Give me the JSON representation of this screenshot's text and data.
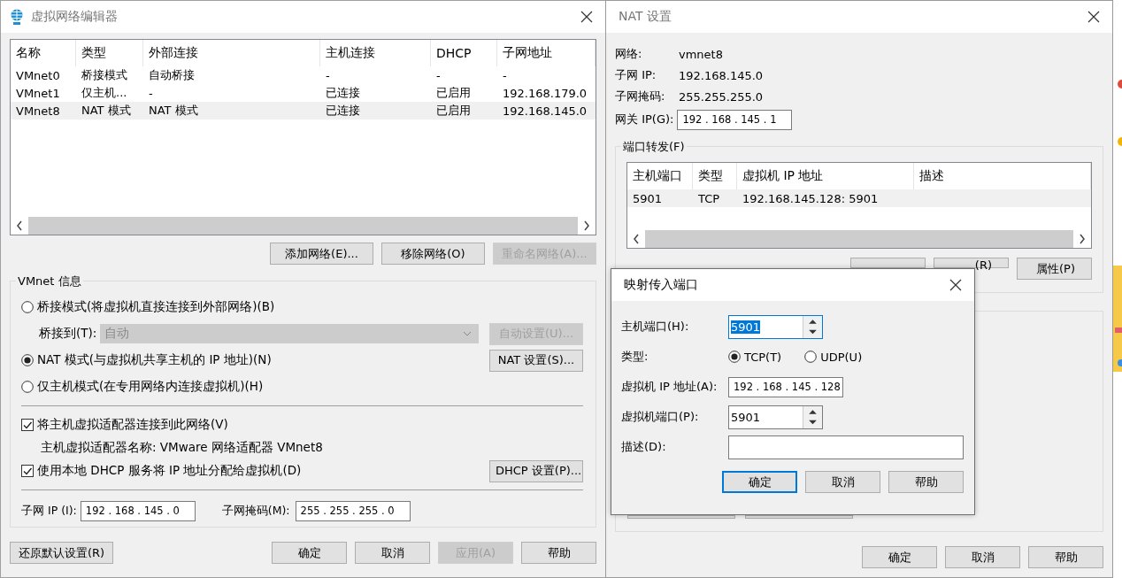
{
  "editor": {
    "title": "虚拟网络编辑器",
    "columns": [
      "名称",
      "类型",
      "外部连接",
      "主机连接",
      "DHCP",
      "子网地址"
    ],
    "rows": [
      {
        "cells": [
          "VMnet0",
          "桥接模式",
          "自动桥接",
          "-",
          "-",
          "-"
        ],
        "selected": false
      },
      {
        "cells": [
          "VMnet1",
          "仅主机...",
          "-",
          "已连接",
          "已启用",
          "192.168.179.0"
        ],
        "selected": false
      },
      {
        "cells": [
          "VMnet8",
          "NAT 模式",
          "NAT 模式",
          "已连接",
          "已启用",
          "192.168.145.0"
        ],
        "selected": true
      }
    ],
    "list_buttons": [
      {
        "label": "添加网络(E)...",
        "disabled": false
      },
      {
        "label": "移除网络(O)",
        "disabled": false
      },
      {
        "label": "重命名网络(A)...",
        "disabled": true
      }
    ],
    "info": {
      "title": "VMnet 信息",
      "modes": [
        {
          "kind": "radio",
          "label": "桥接模式(将虚拟机直接连接到外部网络)(B)",
          "selected": false
        },
        {
          "kind": "select",
          "label": "桥接到(T):",
          "value": "自动",
          "disabled": true,
          "button": {
            "label": "自动设置(U)...",
            "disabled": true
          }
        },
        {
          "kind": "radio",
          "label": "NAT 模式(与虚拟机共享主机的 IP 地址)(N)",
          "selected": true,
          "button": {
            "label": "NAT 设置(S)...",
            "disabled": false
          }
        },
        {
          "kind": "radio",
          "label": "仅主机模式(在专用网络内连接虚拟机)(H)",
          "selected": false
        }
      ],
      "options": [
        {
          "kind": "checkbox",
          "label": "将主机虚拟适配器连接到此网络(V)",
          "checked": true
        },
        {
          "kind": "note",
          "label": "主机虚拟适配器名称: VMware 网络适配器 VMnet8"
        },
        {
          "kind": "checkbox",
          "label": "使用本地 DHCP 服务将 IP 地址分配给虚拟机(D)",
          "checked": true,
          "button": {
            "label": "DHCP 设置(P)...",
            "disabled": false
          }
        }
      ],
      "subnet": [
        {
          "label": "子网 IP (I):",
          "value": "192 . 168 . 145 . 0"
        },
        {
          "label": "子网掩码(M):",
          "value": "255 . 255 . 255 . 0"
        }
      ]
    },
    "restore_button": "还原默认设置(R)",
    "buttons": [
      {
        "label": "确定",
        "disabled": false
      },
      {
        "label": "取消",
        "disabled": false
      },
      {
        "label": "应用(A)",
        "disabled": true
      },
      {
        "label": "帮助",
        "disabled": false
      }
    ]
  },
  "nat": {
    "title": "NAT 设置",
    "info": [
      {
        "label": "网络:",
        "value": "vmnet8"
      },
      {
        "label": "子网 IP:",
        "value": "192.168.145.0"
      },
      {
        "label": "子网掩码:",
        "value": "255.255.255.0"
      }
    ],
    "gateway": {
      "label": "网关 IP(G):",
      "value": "192 . 168 . 145 . 1"
    },
    "port_forwarding": {
      "title": "端口转发(F)",
      "columns": [
        "主机端口",
        "类型",
        "虚拟机 IP 地址",
        "描述"
      ],
      "rows": [
        {
          "cells": [
            "5901",
            "TCP",
            "192.168.145.128: 5901"
          ],
          "selected": true
        }
      ],
      "buttons": [
        {
          "covered": true
        },
        {
          "label": "(R)",
          "covered": true
        },
        {
          "label": "属性(P)",
          "covered": false
        }
      ]
    },
    "buttons": [
      "确定",
      "取消",
      "帮助"
    ]
  },
  "dialog": {
    "title": "映射传入端口",
    "host_port": {
      "label": "主机端口(H):",
      "value": "5901",
      "text_selected": true
    },
    "type": {
      "label": "类型:",
      "options": [
        {
          "label": "TCP(T)",
          "selected": true
        },
        {
          "label": "UDP(U)",
          "selected": false
        }
      ]
    },
    "vm_ip": {
      "label": "虚拟机 IP 地址(A):",
      "value": "192 . 168 . 145 . 128"
    },
    "vm_port": {
      "label": "虚拟机端口(P):",
      "value": "5901",
      "text_selected": false
    },
    "description": {
      "label": "描述(D):"
    },
    "buttons": [
      {
        "label": "确定",
        "default": true
      },
      {
        "label": "取消",
        "default": false
      },
      {
        "label": "帮助",
        "default": false
      }
    ]
  }
}
